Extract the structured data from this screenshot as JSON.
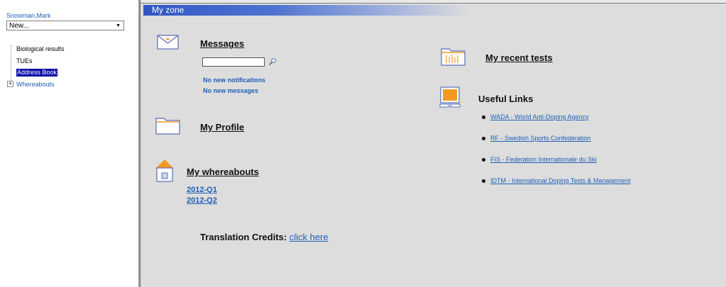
{
  "sidebar": {
    "user_name": "Snowman,Mark",
    "new_select": {
      "value": "New..."
    },
    "tree": [
      {
        "label": "Biological results"
      },
      {
        "label": "TUEs"
      },
      {
        "label": "Address Book",
        "selected": true
      },
      {
        "label": "Whereabouts",
        "expandable": true
      }
    ]
  },
  "main": {
    "zone_title": "My zone",
    "messages": {
      "title": "Messages",
      "search_value": "",
      "notifications": "No new notifications",
      "messages": "No new messages"
    },
    "profile": {
      "title": "My Profile"
    },
    "whereabouts": {
      "title": "My whereabouts",
      "quarters": [
        "2012-Q1",
        "2012-Q2"
      ]
    },
    "recent_tests": {
      "title": "My recent tests"
    },
    "useful_links": {
      "title": "Useful Links",
      "links": [
        "WADA - World Anti-Doping Agency",
        "RF - Swedish Sports Confederation",
        "FIS - Federation Internationale du Ski",
        "IDTM - International Doping Tests & Management"
      ]
    },
    "credits": {
      "label": "Translation Credits:",
      "link": "click here"
    }
  },
  "icons": {
    "messages": "envelope-icon",
    "profile": "folder-icon",
    "whereabouts": "house-icon",
    "recent_tests": "folder-chart-icon",
    "useful_links": "monitor-icon",
    "search": "magnifier-icon"
  },
  "colors": {
    "zone_bar": "#2f56c5",
    "link": "#1f5fb5",
    "selected": "#0a0aa8",
    "accent_orange": "#f39a1e"
  }
}
